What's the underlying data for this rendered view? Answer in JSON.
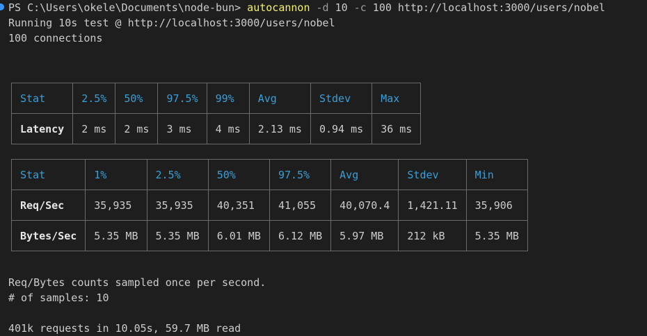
{
  "prompt": {
    "path": "PS C:\\Users\\okele\\Documents\\node-bun> ",
    "command": "autocannon",
    "flag_d": " -d ",
    "value_d": "10",
    "flag_c": " -c ",
    "value_c": "100",
    "url": " http://localhost:3000/users/nobel"
  },
  "header_lines": [
    "Running 10s test @ http://localhost:3000/users/nobel",
    "100 connections"
  ],
  "latency_table": {
    "headers": [
      "Stat",
      "2.5%",
      "50%",
      "97.5%",
      "99%",
      "Avg",
      "Stdev",
      "Max"
    ],
    "row": [
      "Latency",
      "2 ms",
      "2 ms",
      "3 ms",
      "4 ms",
      "2.13 ms",
      "0.94 ms",
      "36 ms"
    ]
  },
  "throughput_table": {
    "headers": [
      "Stat",
      "1%",
      "2.5%",
      "50%",
      "97.5%",
      "Avg",
      "Stdev",
      "Min"
    ],
    "rows": [
      [
        "Req/Sec",
        "35,935",
        "35,935",
        "40,351",
        "41,055",
        "40,070.4",
        "1,421.11",
        "35,906"
      ],
      [
        "Bytes/Sec",
        "5.35 MB",
        "5.35 MB",
        "6.01 MB",
        "6.12 MB",
        "5.97 MB",
        "212 kB",
        "5.35 MB"
      ]
    ]
  },
  "footer_lines": [
    "Req/Bytes counts sampled once per second.",
    "# of samples: 10",
    "401k requests in 10.05s, 59.7 MB read"
  ],
  "colors": {
    "background": "#1e1e1e",
    "text": "#cccccc",
    "command": "#f2f26b",
    "header_cell": "#3a9fd8",
    "border": "#6b6b6b",
    "prompt_marker": "#3794ff"
  }
}
